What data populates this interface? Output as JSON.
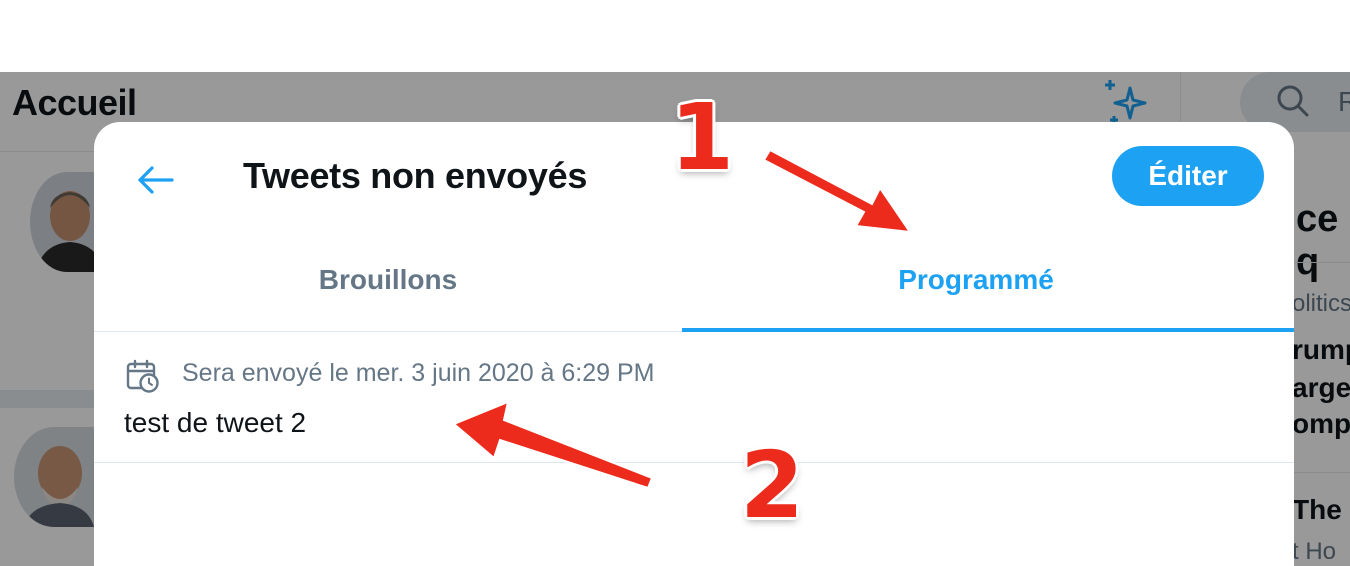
{
  "background": {
    "home_title": "Accueil",
    "search_partial": "R",
    "sidebar": {
      "heading_partial": "ce q",
      "category_partial": "olitics",
      "lines": [
        "rump",
        "arget",
        "omp"
      ],
      "second_heading_partial": "The",
      "second_sub_partial": "t Ho"
    }
  },
  "modal": {
    "title": "Tweets non envoyés",
    "edit_label": "Éditer",
    "tabs": [
      {
        "label": "Brouillons",
        "active": false
      },
      {
        "label": "Programmé",
        "active": true
      }
    ],
    "scheduled_tweets": [
      {
        "schedule_text": "Sera envoyé le mer. 3 juin 2020 à 6:29 PM",
        "text": "test de tweet 2"
      }
    ]
  },
  "annotations": {
    "step1": "1",
    "step2": "2"
  },
  "colors": {
    "accent": "#1da1f2",
    "annotation": "#ec2b1c",
    "muted_text": "#657786",
    "text": "#0f1419"
  },
  "icons": [
    "back-arrow-icon",
    "sparkle-icon",
    "search-icon",
    "calendar-clock-icon"
  ]
}
